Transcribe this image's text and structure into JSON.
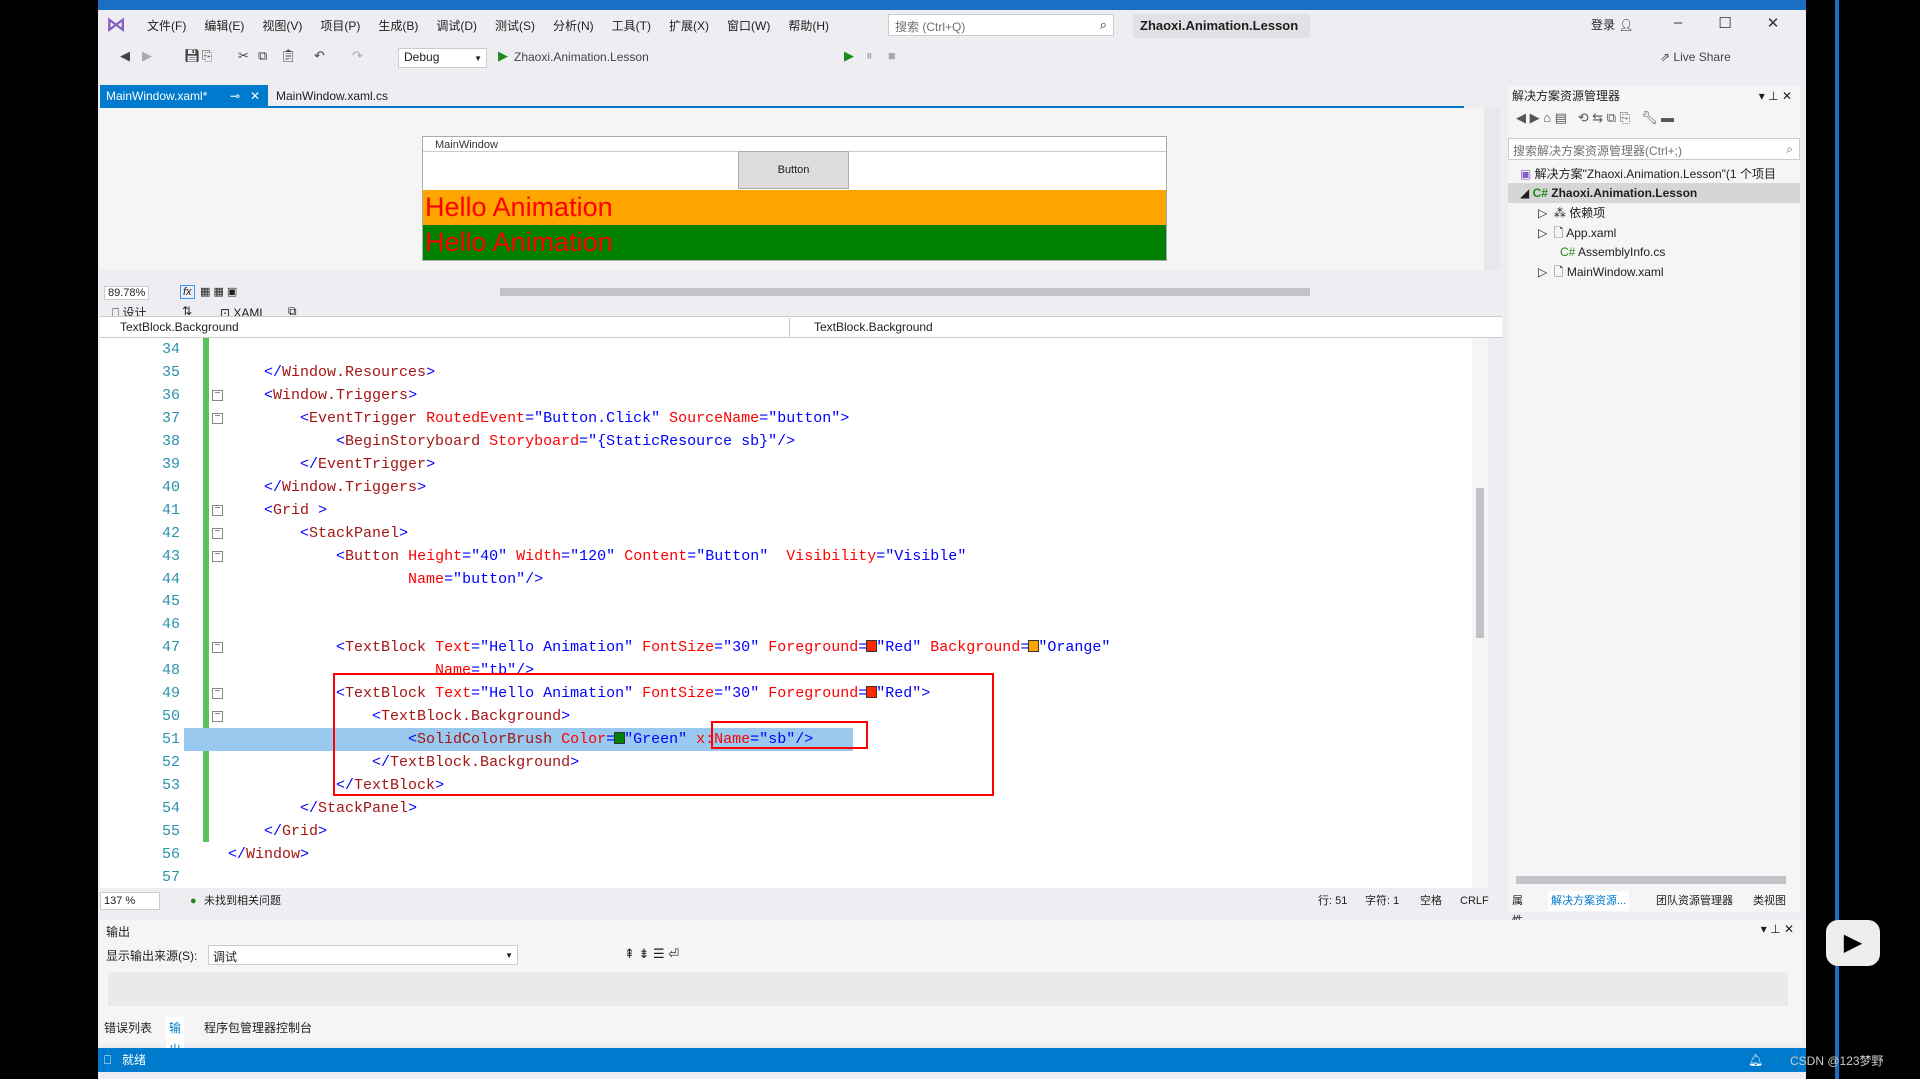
{
  "app": {
    "title": "Zhaoxi.Animation.Lesson",
    "menu": [
      "文件(F)",
      "编辑(E)",
      "视图(V)",
      "项目(P)",
      "生成(B)",
      "调试(D)",
      "测试(S)",
      "分析(N)",
      "工具(T)",
      "扩展(X)",
      "窗口(W)",
      "帮助(H)"
    ],
    "search_placeholder": "搜索 (Ctrl+Q)",
    "login": "登录",
    "live_share": "Live Share"
  },
  "toolbar": {
    "config": "Debug",
    "startup_project": "Zhaoxi.Animation.Lesson"
  },
  "tabs": [
    {
      "label": "MainWindow.xaml*",
      "active": true
    },
    {
      "label": "MainWindow.xaml.cs",
      "active": false
    }
  ],
  "designer": {
    "window_title": "MainWindow",
    "button_label": "Button",
    "textblock1": {
      "text": "Hello Animation",
      "foreground": "#ff0000",
      "background": "#ffa500"
    },
    "textblock2": {
      "text": "Hello Animation",
      "foreground": "#ff0000",
      "background": "#008000"
    },
    "zoom": "89.78%",
    "design_tab": "设计",
    "xaml_tab": "XAML"
  },
  "nav": {
    "left": "TextBlock.Background",
    "right": "TextBlock.Background"
  },
  "code": {
    "selected_line": 51,
    "lines": [
      {
        "n": "34",
        "tokens": []
      },
      {
        "n": "35",
        "tokens": [
          [
            "x",
            "    "
          ],
          [
            "p",
            "</"
          ],
          [
            "t",
            "Window.Resources"
          ],
          [
            "p",
            ">"
          ]
        ]
      },
      {
        "n": "36",
        "tokens": [
          [
            "x",
            "    "
          ],
          [
            "p",
            "<"
          ],
          [
            "t",
            "Window.Triggers"
          ],
          [
            "p",
            ">"
          ]
        ]
      },
      {
        "n": "37",
        "tokens": [
          [
            "x",
            "        "
          ],
          [
            "p",
            "<"
          ],
          [
            "t",
            "EventTrigger"
          ],
          [
            "a",
            " RoutedEvent"
          ],
          [
            "p",
            "=\""
          ],
          [
            "v",
            "Button.Click"
          ],
          [
            "p",
            "\""
          ],
          [
            "a",
            " SourceName"
          ],
          [
            "p",
            "=\""
          ],
          [
            "v",
            "button"
          ],
          [
            "p",
            "\">"
          ]
        ]
      },
      {
        "n": "38",
        "tokens": [
          [
            "x",
            "            "
          ],
          [
            "p",
            "<"
          ],
          [
            "t",
            "BeginStoryboard"
          ],
          [
            "a",
            " Storyboard"
          ],
          [
            "p",
            "=\""
          ],
          [
            "v",
            "{StaticResource sb}"
          ],
          [
            "p",
            "\"/>"
          ]
        ]
      },
      {
        "n": "39",
        "tokens": [
          [
            "x",
            "        "
          ],
          [
            "p",
            "</"
          ],
          [
            "t",
            "EventTrigger"
          ],
          [
            "p",
            ">"
          ]
        ]
      },
      {
        "n": "40",
        "tokens": [
          [
            "x",
            "    "
          ],
          [
            "p",
            "</"
          ],
          [
            "t",
            "Window.Triggers"
          ],
          [
            "p",
            ">"
          ]
        ]
      },
      {
        "n": "41",
        "tokens": [
          [
            "x",
            "    "
          ],
          [
            "p",
            "<"
          ],
          [
            "t",
            "Grid"
          ],
          [
            "p",
            " >"
          ]
        ]
      },
      {
        "n": "42",
        "tokens": [
          [
            "x",
            "        "
          ],
          [
            "p",
            "<"
          ],
          [
            "t",
            "StackPanel"
          ],
          [
            "p",
            ">"
          ]
        ]
      },
      {
        "n": "43",
        "tokens": [
          [
            "x",
            "            "
          ],
          [
            "p",
            "<"
          ],
          [
            "t",
            "Button"
          ],
          [
            "a",
            " Height"
          ],
          [
            "p",
            "=\""
          ],
          [
            "v",
            "40"
          ],
          [
            "p",
            "\""
          ],
          [
            "a",
            " Width"
          ],
          [
            "p",
            "=\""
          ],
          [
            "v",
            "120"
          ],
          [
            "p",
            "\""
          ],
          [
            "a",
            " Content"
          ],
          [
            "p",
            "=\""
          ],
          [
            "v",
            "Button"
          ],
          [
            "p",
            "\""
          ],
          [
            "a",
            "  Visibility"
          ],
          [
            "p",
            "=\""
          ],
          [
            "v",
            "Visible"
          ],
          [
            "p",
            "\""
          ]
        ]
      },
      {
        "n": "44",
        "tokens": [
          [
            "x",
            "                    "
          ],
          [
            "a",
            "Name"
          ],
          [
            "p",
            "=\""
          ],
          [
            "v",
            "button"
          ],
          [
            "p",
            "\"/>"
          ]
        ]
      },
      {
        "n": "45",
        "tokens": []
      },
      {
        "n": "46",
        "tokens": []
      },
      {
        "n": "47",
        "tokens": [
          [
            "x",
            "            "
          ],
          [
            "p",
            "<"
          ],
          [
            "t",
            "TextBlock"
          ],
          [
            "a",
            " Text"
          ],
          [
            "p",
            "=\""
          ],
          [
            "v",
            "Hello Animation"
          ],
          [
            "p",
            "\""
          ],
          [
            "a",
            " FontSize"
          ],
          [
            "p",
            "=\""
          ],
          [
            "v",
            "30"
          ],
          [
            "p",
            "\""
          ],
          [
            "a",
            " Foreground"
          ],
          [
            "p",
            "="
          ],
          [
            "s",
            "#ff2a00"
          ],
          [
            "p",
            "\""
          ],
          [
            "v",
            "Red"
          ],
          [
            "p",
            "\""
          ],
          [
            "a",
            " Background"
          ],
          [
            "p",
            "="
          ],
          [
            "s",
            "#ffa500"
          ],
          [
            "p",
            "\""
          ],
          [
            "v",
            "Orange"
          ],
          [
            "p",
            "\""
          ]
        ]
      },
      {
        "n": "48",
        "tokens": [
          [
            "x",
            "                       "
          ],
          [
            "a",
            "Name"
          ],
          [
            "p",
            "=\""
          ],
          [
            "v",
            "tb"
          ],
          [
            "p",
            "\"/>"
          ]
        ]
      },
      {
        "n": "49",
        "tokens": [
          [
            "x",
            "            "
          ],
          [
            "p",
            "<"
          ],
          [
            "t",
            "TextBlock"
          ],
          [
            "a",
            " Text"
          ],
          [
            "p",
            "=\""
          ],
          [
            "v",
            "Hello Animation"
          ],
          [
            "p",
            "\""
          ],
          [
            "a",
            " FontSize"
          ],
          [
            "p",
            "=\""
          ],
          [
            "v",
            "30"
          ],
          [
            "p",
            "\""
          ],
          [
            "a",
            " Foreground"
          ],
          [
            "p",
            "="
          ],
          [
            "s",
            "#ff2a00"
          ],
          [
            "p",
            "\""
          ],
          [
            "v",
            "Red"
          ],
          [
            "p",
            "\">"
          ]
        ]
      },
      {
        "n": "50",
        "tokens": [
          [
            "x",
            "                "
          ],
          [
            "p",
            "<"
          ],
          [
            "t",
            "TextBlock.Background"
          ],
          [
            "p",
            ">"
          ]
        ]
      },
      {
        "n": "51",
        "tokens": [
          [
            "x",
            "                    "
          ],
          [
            "p",
            "<"
          ],
          [
            "t",
            "SolidColorBrush"
          ],
          [
            "a",
            " Color"
          ],
          [
            "p",
            "="
          ],
          [
            "s",
            "#008000"
          ],
          [
            "p",
            "\""
          ],
          [
            "v",
            "Green"
          ],
          [
            "p",
            "\""
          ],
          [
            "a",
            " x:Name"
          ],
          [
            "p",
            "=\""
          ],
          [
            "v",
            "sb"
          ],
          [
            "p",
            "\"/>"
          ]
        ]
      },
      {
        "n": "52",
        "tokens": [
          [
            "x",
            "                "
          ],
          [
            "p",
            "</"
          ],
          [
            "t",
            "TextBlock.Background"
          ],
          [
            "p",
            ">"
          ]
        ]
      },
      {
        "n": "53",
        "tokens": [
          [
            "x",
            "            "
          ],
          [
            "p",
            "</"
          ],
          [
            "t",
            "TextBlock"
          ],
          [
            "p",
            ">"
          ]
        ]
      },
      {
        "n": "54",
        "tokens": [
          [
            "x",
            "        "
          ],
          [
            "p",
            "</"
          ],
          [
            "t",
            "StackPanel"
          ],
          [
            "p",
            ">"
          ]
        ]
      },
      {
        "n": "55",
        "tokens": [
          [
            "x",
            "    "
          ],
          [
            "p",
            "</"
          ],
          [
            "t",
            "Grid"
          ],
          [
            "p",
            ">"
          ]
        ]
      },
      {
        "n": "56",
        "tokens": [
          [
            "p",
            "</"
          ],
          [
            "t",
            "Window"
          ],
          [
            "p",
            ">"
          ]
        ]
      },
      {
        "n": "57",
        "tokens": []
      }
    ]
  },
  "editor_status": {
    "zoom": "137 %",
    "issues": "未找到相关问题",
    "line": "行: 51",
    "char": "字符: 1",
    "spaces": "空格",
    "eol": "CRLF"
  },
  "solution_explorer": {
    "title": "解决方案资源管理器",
    "search_placeholder": "搜索解决方案资源管理器(Ctrl+;)",
    "items": [
      {
        "label": "解决方案\"Zhaoxi.Animation.Lesson\"(1 个项目"
      },
      {
        "label": "Zhaoxi.Animation.Lesson"
      },
      {
        "label": "依赖项"
      },
      {
        "label": "App.xaml"
      },
      {
        "label": "AssemblyInfo.cs"
      },
      {
        "label": "MainWindow.xaml"
      }
    ],
    "bottom_tabs": [
      "属性",
      "解决方案资源...",
      "团队资源管理器",
      "类视图"
    ]
  },
  "output": {
    "title": "输出",
    "source_label": "显示输出来源(S):",
    "source_value": "调试"
  },
  "bottom_tabs": [
    "错误列表",
    "输出",
    "程序包管理器控制台"
  ],
  "status": {
    "text": "就绪"
  },
  "watermark": "CSDN @123梦野",
  "colors": {
    "accent": "#007acc",
    "highlight_box": "#ff0000",
    "selection": "#99c9ef"
  }
}
